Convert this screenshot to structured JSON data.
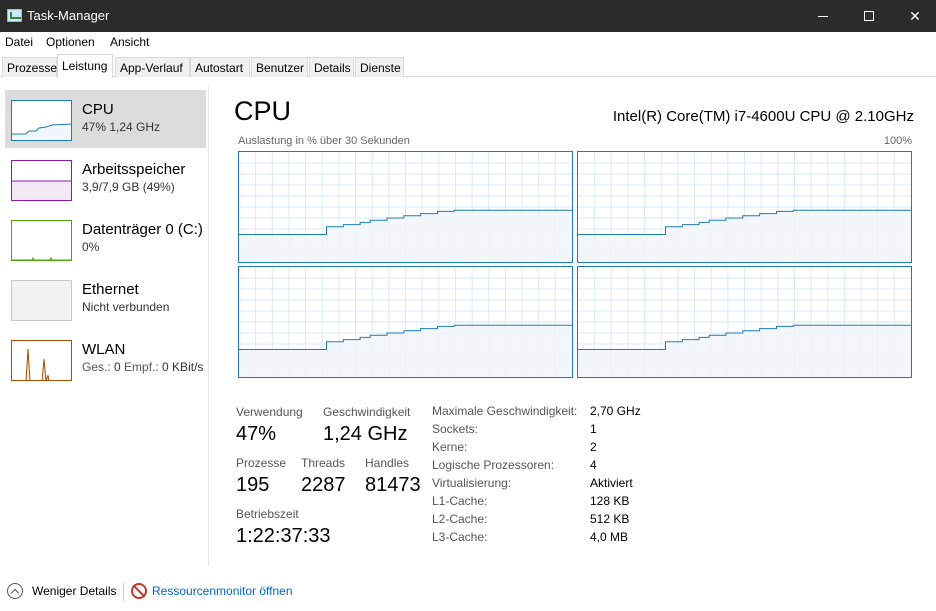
{
  "window": {
    "title": "Task-Manager"
  },
  "menu": [
    "Datei",
    "Optionen",
    "Ansicht"
  ],
  "tabs": [
    {
      "label": "Prozesse",
      "active": false
    },
    {
      "label": "Leistung",
      "active": true
    },
    {
      "label": "App-Verlauf",
      "active": false
    },
    {
      "label": "Autostart",
      "active": false
    },
    {
      "label": "Benutzer",
      "active": false
    },
    {
      "label": "Details",
      "active": false
    },
    {
      "label": "Dienste",
      "active": false
    }
  ],
  "sidebar": {
    "items": [
      {
        "title": "CPU",
        "sub": "47% 1,24 GHz",
        "color": "#1c7cb5"
      },
      {
        "title": "Arbeitsspeicher",
        "sub": "3,9/7,9 GB (49%)",
        "color": "#8b1aa8"
      },
      {
        "title": "Datenträger 0 (C:)",
        "sub": "0%",
        "color": "#4da60c"
      },
      {
        "title": "Ethernet",
        "sub": "Nicht verbunden",
        "color": "#bbbbbb"
      },
      {
        "title": "WLAN",
        "sub_parts": [
          "Ges.: ",
          "0",
          " Empf.: ",
          "0 KBit/s"
        ],
        "color": "#a74f01"
      }
    ]
  },
  "main": {
    "title": "CPU",
    "model": "Intel(R) Core(TM) i7-4600U CPU @ 2.10GHz",
    "graph_label": "Auslastung in % über 30 Sekunden",
    "graph_max": "100%",
    "accent": "#1c7cb5",
    "fill": "#f1f6fa"
  },
  "stats": {
    "usage_label": "Verwendung",
    "usage_value": "47%",
    "speed_label": "Geschwindigkeit",
    "speed_value": "1,24 GHz",
    "processes_label": "Prozesse",
    "processes_value": "195",
    "threads_label": "Threads",
    "threads_value": "2287",
    "handles_label": "Handles",
    "handles_value": "81473",
    "uptime_label": "Betriebszeit",
    "uptime_value": "1:22:37:33"
  },
  "specs": [
    {
      "label": "Maximale Geschwindigkeit:",
      "value": "2,70 GHz"
    },
    {
      "label": "Sockets:",
      "value": "1"
    },
    {
      "label": "Kerne:",
      "value": "2"
    },
    {
      "label": "Logische Prozessoren:",
      "value": "4"
    },
    {
      "label": "Virtualisierung:",
      "value": "Aktiviert"
    },
    {
      "label": "L1-Cache:",
      "value": "128 KB"
    },
    {
      "label": "L2-Cache:",
      "value": "512 KB"
    },
    {
      "label": "L3-Cache:",
      "value": "4,0 MB"
    }
  ],
  "footer": {
    "fewer_details": "Weniger Details",
    "resource_monitor": "Ressourcenmonitor öffnen"
  },
  "chart_data": {
    "type": "area",
    "series_per_core": [
      [
        25,
        25,
        25,
        25,
        25,
        25,
        25,
        25,
        25,
        25,
        25,
        25,
        25,
        25,
        25,
        25,
        25,
        25,
        25,
        25,
        25,
        25,
        25,
        25,
        25,
        25,
        32,
        32,
        32,
        32,
        32,
        34,
        34,
        34,
        34,
        34,
        36,
        36,
        36,
        38,
        38,
        38,
        38,
        38,
        40,
        40,
        40,
        40,
        40,
        42,
        42,
        42,
        42,
        42,
        44,
        44,
        44,
        44,
        44,
        46,
        46,
        46,
        46,
        46,
        47,
        47,
        47,
        47,
        47,
        47,
        47,
        47,
        47,
        47,
        47,
        47,
        47,
        47,
        47,
        47,
        47,
        47,
        47,
        47,
        47,
        47,
        47,
        47,
        47,
        47,
        47,
        47,
        47,
        47,
        47,
        47,
        47,
        47,
        47,
        47
      ],
      [
        25,
        25,
        25,
        25,
        25,
        25,
        25,
        25,
        25,
        25,
        25,
        25,
        25,
        25,
        25,
        25,
        25,
        25,
        25,
        25,
        25,
        25,
        25,
        25,
        25,
        25,
        32,
        32,
        32,
        32,
        32,
        34,
        34,
        34,
        34,
        34,
        36,
        36,
        36,
        38,
        38,
        38,
        38,
        38,
        40,
        40,
        40,
        40,
        40,
        42,
        42,
        42,
        42,
        42,
        44,
        44,
        44,
        44,
        44,
        46,
        46,
        46,
        46,
        46,
        47,
        47,
        47,
        47,
        47,
        47,
        47,
        47,
        47,
        47,
        47,
        47,
        47,
        47,
        47,
        47,
        47,
        47,
        47,
        47,
        47,
        47,
        47,
        47,
        47,
        47,
        47,
        47,
        47,
        47,
        47,
        47,
        47,
        47,
        47,
        47
      ],
      [
        25,
        25,
        25,
        25,
        25,
        25,
        25,
        25,
        25,
        25,
        25,
        25,
        25,
        25,
        25,
        25,
        25,
        25,
        25,
        25,
        25,
        25,
        25,
        25,
        25,
        25,
        32,
        32,
        32,
        32,
        32,
        34,
        34,
        34,
        34,
        34,
        36,
        36,
        36,
        38,
        38,
        38,
        38,
        38,
        40,
        40,
        40,
        40,
        40,
        42,
        42,
        42,
        42,
        42,
        44,
        44,
        44,
        44,
        44,
        46,
        46,
        46,
        46,
        46,
        47,
        47,
        47,
        47,
        47,
        47,
        47,
        47,
        47,
        47,
        47,
        47,
        47,
        47,
        47,
        47,
        47,
        47,
        47,
        47,
        47,
        47,
        47,
        47,
        47,
        47,
        47,
        47,
        47,
        47,
        47,
        47,
        47,
        47,
        47,
        47
      ],
      [
        25,
        25,
        25,
        25,
        25,
        25,
        25,
        25,
        25,
        25,
        25,
        25,
        25,
        25,
        25,
        25,
        25,
        25,
        25,
        25,
        25,
        25,
        25,
        25,
        25,
        25,
        32,
        32,
        32,
        32,
        32,
        34,
        34,
        34,
        34,
        34,
        36,
        36,
        36,
        38,
        38,
        38,
        38,
        38,
        40,
        40,
        40,
        40,
        40,
        42,
        42,
        42,
        42,
        42,
        44,
        44,
        44,
        44,
        44,
        46,
        46,
        46,
        46,
        46,
        47,
        47,
        47,
        47,
        47,
        47,
        47,
        47,
        47,
        47,
        47,
        47,
        47,
        47,
        47,
        47,
        47,
        47,
        47,
        47,
        47,
        47,
        47,
        47,
        47,
        47,
        47,
        47,
        47,
        47,
        47,
        47,
        47,
        47,
        47,
        47
      ]
    ],
    "ylim": [
      0,
      100
    ],
    "grid": true
  }
}
